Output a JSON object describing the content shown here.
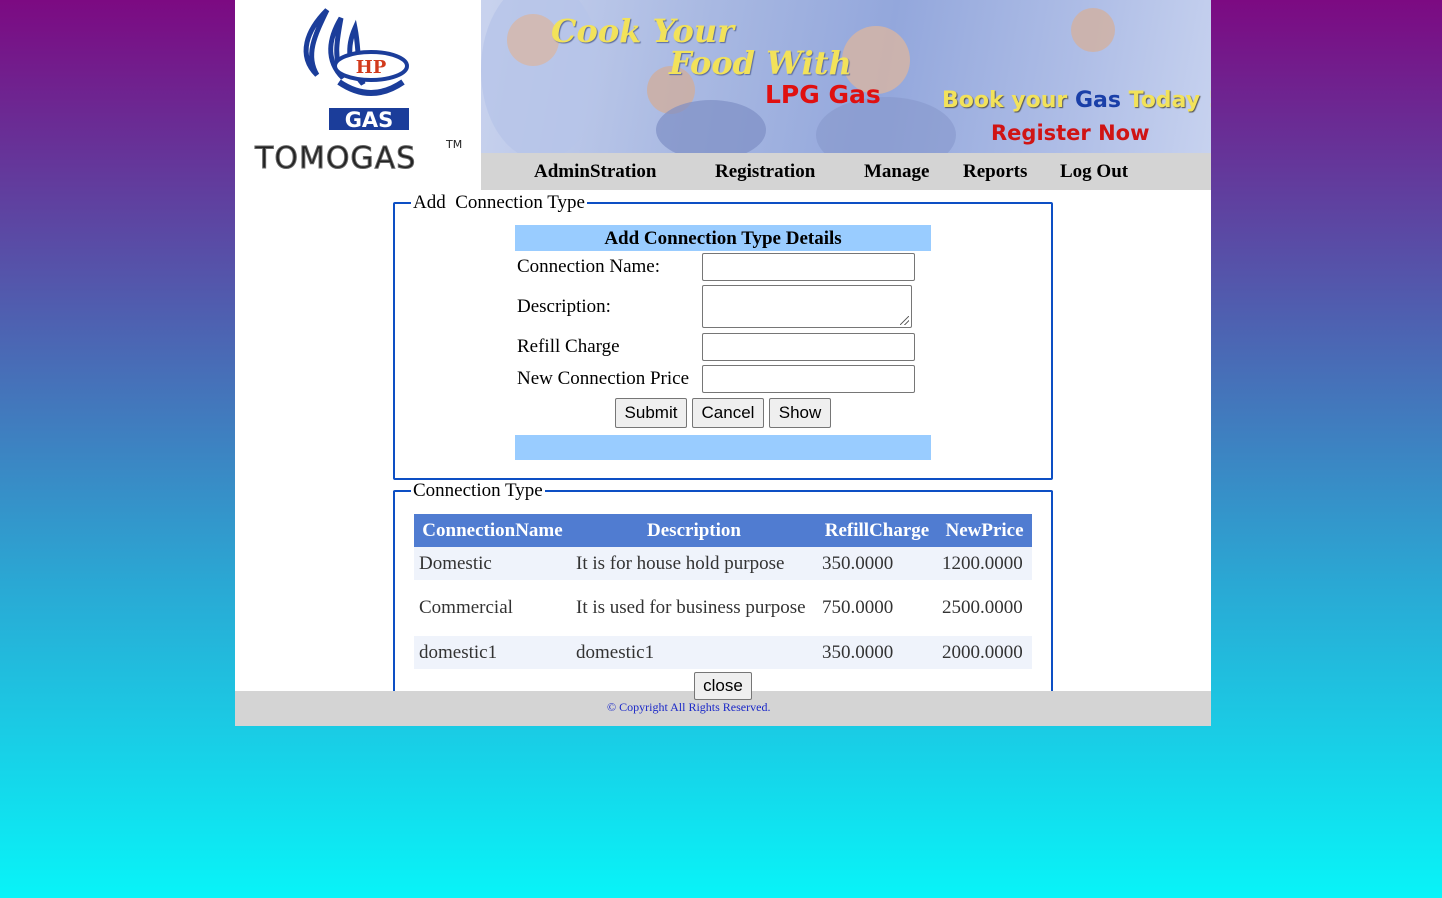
{
  "brand": {
    "logo_text": "TOMOGAS",
    "logo_badge": "HP",
    "logo_gas": "GAS",
    "trademark": "TM"
  },
  "banner": {
    "line1": "Cook Your",
    "line2": "Food With",
    "line3": "LPG Gas",
    "tagline_prefix": "Book your",
    "tagline_gas": "Gas",
    "tagline_suffix": "Today !",
    "register": "Register Now"
  },
  "nav": {
    "items": [
      "AdminStration",
      "Registration",
      "Manage",
      "Reports",
      "Log Out"
    ]
  },
  "add_form": {
    "legend": "Add  Connection Type",
    "header": "Add Connection Type Details",
    "connection_name_label": "Connection Name:",
    "description_label": "Description:",
    "refill_charge_label": "Refill Charge",
    "new_connection_price_label": "New Connection Price",
    "connection_name_value": "",
    "description_value": "",
    "refill_charge_value": "",
    "new_connection_price_value": "",
    "submit_label": "Submit",
    "cancel_label": "Cancel",
    "show_label": "Show"
  },
  "list": {
    "legend": "Connection Type",
    "columns": [
      "ConnectionName",
      "Description",
      "RefillCharge",
      "NewPrice"
    ],
    "rows": [
      [
        "Domestic",
        "It is for house hold purpose",
        "350.0000",
        "1200.0000"
      ],
      [
        "Commercial",
        "It is used for business purpose",
        "750.0000",
        "2500.0000"
      ],
      [
        "domestic1",
        "domestic1",
        "350.0000",
        "2000.0000"
      ]
    ],
    "close_label": "close"
  },
  "footer": {
    "copyright": "© Copyright All Rights Reserved."
  },
  "colors": {
    "accent_border": "#0d4fc4",
    "form_bar": "#99ccff",
    "table_header": "#507cd1",
    "table_alt_row": "#eff3fb",
    "nav_bg": "#d4d4d4"
  }
}
